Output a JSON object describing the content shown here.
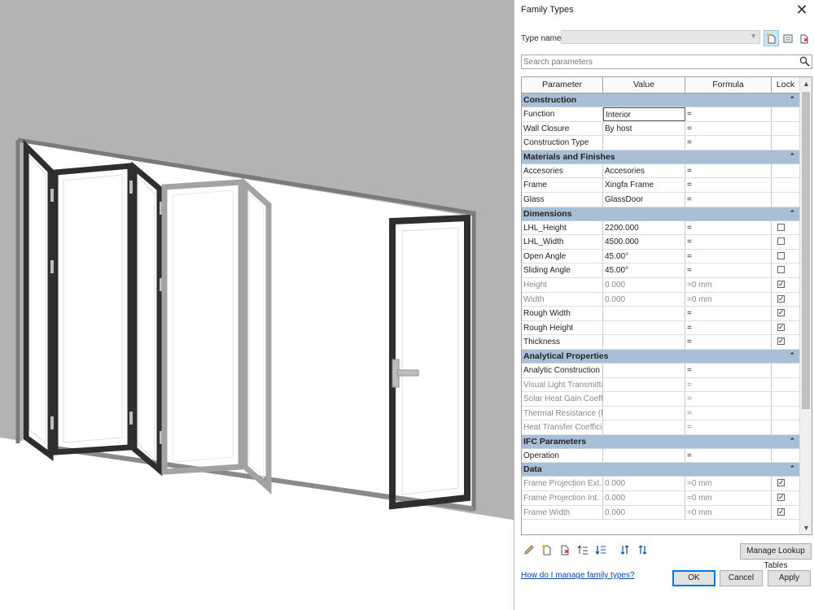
{
  "dialog": {
    "title": "Family Types",
    "close_glyph": "✕",
    "type_name_label": "Type name:",
    "type_name_value": "",
    "search_placeholder": "Search parameters",
    "help_link": "How do I manage family types?",
    "manage_lookup_label": "Manage Lookup Tables",
    "ok_label": "OK",
    "cancel_label": "Cancel",
    "apply_label": "Apply"
  },
  "grid": {
    "headers": [
      "Parameter",
      "Value",
      "Formula",
      "Lock"
    ],
    "groups": [
      {
        "name": "Construction",
        "rows": [
          {
            "param": "Function",
            "value": "Interior",
            "formula": "=",
            "lock": null,
            "dim": false
          },
          {
            "param": "Wall Closure",
            "value": "By host",
            "formula": "=",
            "lock": null,
            "dim": false
          },
          {
            "param": "Construction Type",
            "value": "",
            "formula": "=",
            "lock": null,
            "dim": false
          }
        ]
      },
      {
        "name": "Materials and Finishes",
        "rows": [
          {
            "param": "Accesories",
            "value": "Accesories",
            "formula": "=",
            "lock": null,
            "dim": false
          },
          {
            "param": "Frame",
            "value": "Xingfa Frame",
            "formula": "=",
            "lock": null,
            "dim": false
          },
          {
            "param": "Glass",
            "value": "GlassDoor",
            "formula": "=",
            "lock": null,
            "dim": false
          }
        ]
      },
      {
        "name": "Dimensions",
        "rows": [
          {
            "param": "LHL_Height",
            "value": "2200.000",
            "formula": "=",
            "lock": false,
            "dim": false
          },
          {
            "param": "LHL_Width",
            "value": "4500.000",
            "formula": "=",
            "lock": false,
            "dim": false
          },
          {
            "param": "Open Angle",
            "value": "45.00°",
            "formula": "=",
            "lock": false,
            "dim": false
          },
          {
            "param": "Sliding Angle",
            "value": "45.00°",
            "formula": "=",
            "lock": false,
            "dim": false
          },
          {
            "param": "Height",
            "value": "0.000",
            "formula": "=0 mm",
            "lock": true,
            "dim": true
          },
          {
            "param": "Width",
            "value": "0.000",
            "formula": "=0 mm",
            "lock": true,
            "dim": true
          },
          {
            "param": "Rough Width",
            "value": "",
            "formula": "=",
            "lock": true,
            "dim": false
          },
          {
            "param": "Rough Height",
            "value": "",
            "formula": "=",
            "lock": true,
            "dim": false
          },
          {
            "param": "Thickness",
            "value": "",
            "formula": "=",
            "lock": true,
            "dim": false
          }
        ]
      },
      {
        "name": "Analytical Properties",
        "rows": [
          {
            "param": "Analytic Construction",
            "value": "",
            "formula": "=",
            "lock": null,
            "dim": false
          },
          {
            "param": "Visual Light Transmittan",
            "value": "",
            "formula": "=",
            "lock": null,
            "dim": true
          },
          {
            "param": "Solar Heat Gain Coeffici",
            "value": "",
            "formula": "=",
            "lock": null,
            "dim": true
          },
          {
            "param": "Thermal Resistance (R)",
            "value": "",
            "formula": "=",
            "lock": null,
            "dim": true
          },
          {
            "param": "Heat Transfer Coefficien",
            "value": "",
            "formula": "=",
            "lock": null,
            "dim": true
          }
        ]
      },
      {
        "name": "IFC Parameters",
        "rows": [
          {
            "param": "Operation",
            "value": "",
            "formula": "=",
            "lock": null,
            "dim": false
          }
        ]
      },
      {
        "name": "Data",
        "rows": [
          {
            "param": "Frame Projection Ext.",
            "value": "0.000",
            "formula": "=0 mm",
            "lock": true,
            "dim": true
          },
          {
            "param": "Frame Projection Int.",
            "value": "0.000",
            "formula": "=0 mm",
            "lock": true,
            "dim": true
          },
          {
            "param": "Frame Width",
            "value": "0.000",
            "formula": "=0 mm",
            "lock": true,
            "dim": true
          }
        ]
      }
    ]
  },
  "toolbar_icons": [
    "pencil-icon",
    "new-parameter-icon",
    "delete-parameter-icon",
    "move-up-icon",
    "move-down-icon",
    "sort-ascending-icon",
    "sort-descending-icon"
  ],
  "colors": {
    "group_header": "#a9bfd8",
    "link": "#0645ad",
    "primary_border": "#0078d7",
    "viewport_wall": "#b3b3b3"
  }
}
